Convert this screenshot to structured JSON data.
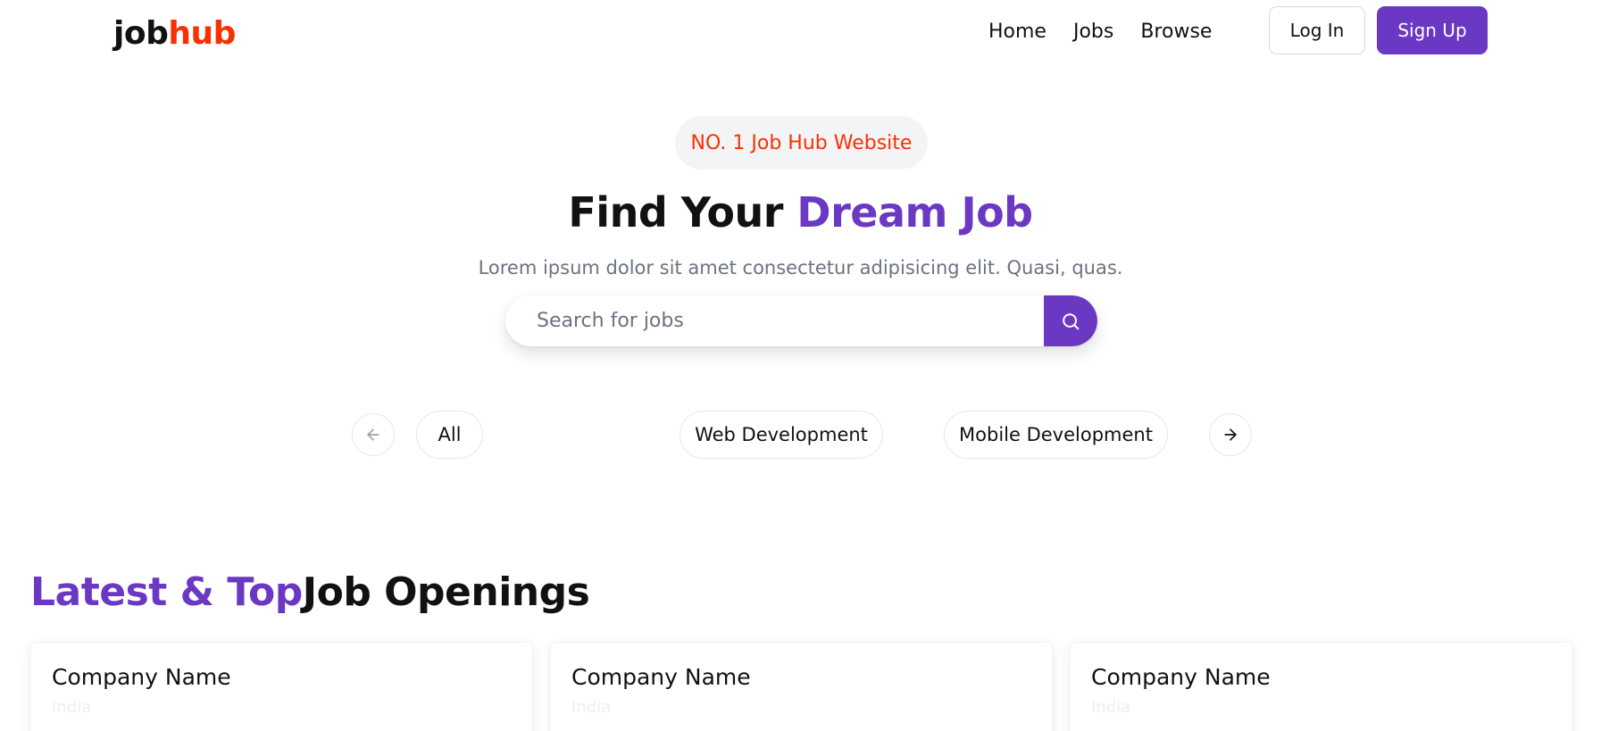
{
  "brand": {
    "part1": "job",
    "part2": "hub",
    "accent": "#f83002"
  },
  "nav": {
    "links": [
      "Home",
      "Jobs",
      "Browse"
    ],
    "login_label": "Log In",
    "signup_label": "Sign Up"
  },
  "colors": {
    "primary": "#6a38c2",
    "accent": "#f83002",
    "muted": "#6b7280"
  },
  "hero": {
    "badge": "NO. 1 Job Hub Website",
    "title_plain": "Find Your ",
    "title_highlight": "Dream Job",
    "subtitle": "Lorem ipsum dolor sit amet consectetur adipisicing elit. Quasi, quas.",
    "search_placeholder": "Search for jobs",
    "search_icon": "search-icon"
  },
  "categories": {
    "prev_icon": "arrow-left-icon",
    "next_icon": "arrow-right-icon",
    "items": [
      "All",
      "Web Development",
      "Mobile Development"
    ]
  },
  "latest_jobs": {
    "title_highlight": "Latest & Top",
    "title_plain": "Job Openings",
    "cards": [
      {
        "company": "Company Name",
        "location": "India"
      },
      {
        "company": "Company Name",
        "location": "India"
      },
      {
        "company": "Company Name",
        "location": "India"
      }
    ]
  }
}
